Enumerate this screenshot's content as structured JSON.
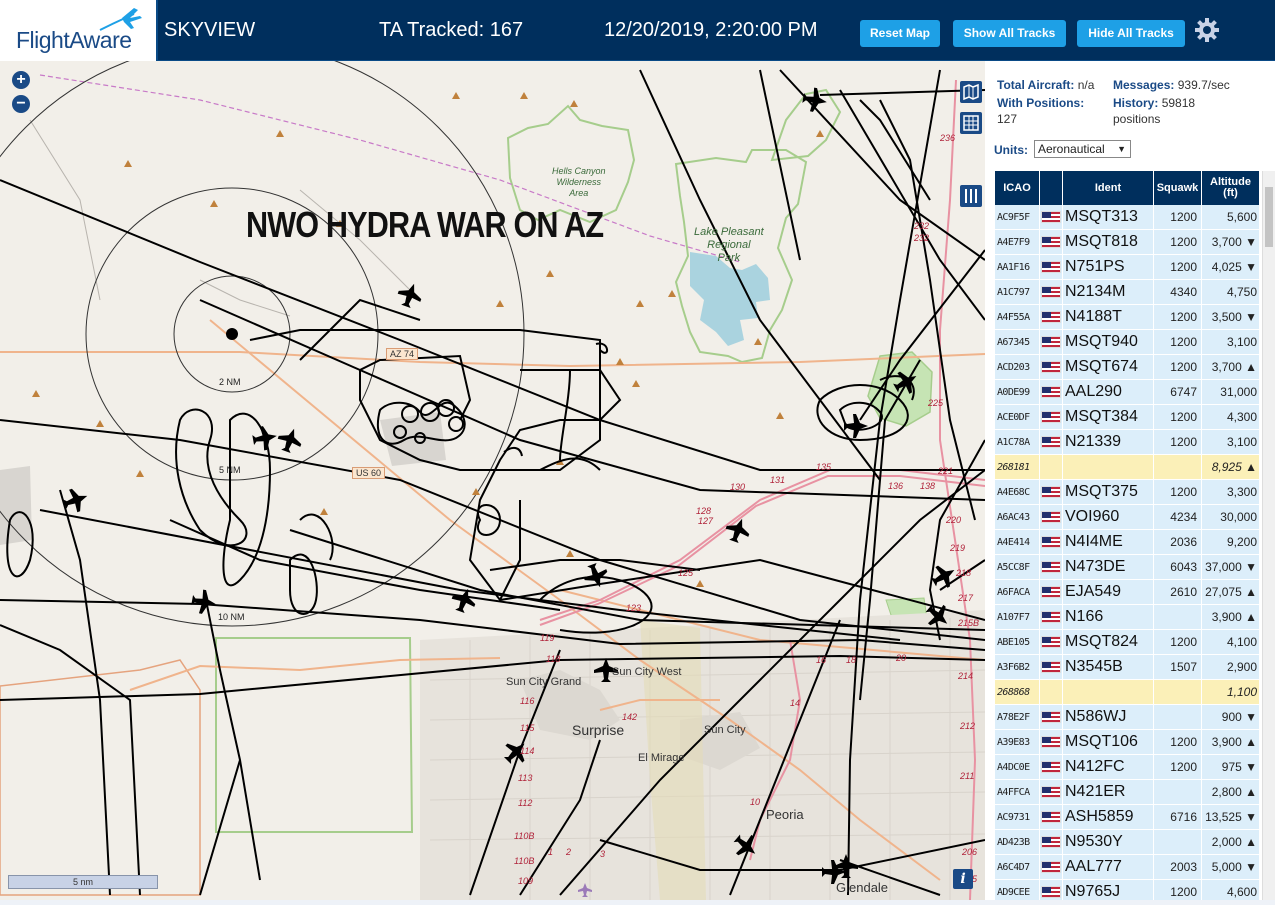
{
  "header": {
    "logo_text": "FlightAware",
    "app_title": "SKYVIEW",
    "tracked": "TA Tracked: 167",
    "datetime": "12/20/2019, 2:20:00 PM",
    "buttons": {
      "reset": "Reset Map",
      "show_all": "Show All Tracks",
      "hide_all": "Hide All Tracks"
    }
  },
  "map": {
    "overlay_title": "NWO HYDRA WAR ON AZ",
    "scale": "5 nm",
    "range_rings": [
      "2 NM",
      "5 NM",
      "10 NM"
    ],
    "places": {
      "hells_canyon": "Hells Canyon\nWilderness\nArea",
      "lake_pleasant": "Lake Pleasant\nRegional\nPark",
      "sun_city_grand": "Sun City Grand",
      "sun_city_west": "Sun City West",
      "surprise": "Surprise",
      "sun_city": "Sun City",
      "el_mirage": "El Mirage",
      "peoria": "Peoria",
      "glendale": "Glendale"
    },
    "roads": {
      "az74": "AZ 74",
      "us60": "US 60"
    },
    "route_numbers": [
      "119",
      "116",
      "115",
      "114",
      "113",
      "112",
      "110B",
      "110B",
      "109",
      "118",
      "125",
      "123",
      "128",
      "127",
      "130",
      "131",
      "135",
      "136",
      "138",
      "142",
      "232",
      "232",
      "225",
      "221",
      "220",
      "219",
      "218",
      "217",
      "215B",
      "214",
      "212",
      "211",
      "206",
      "205",
      "236",
      "10",
      "14",
      "16",
      "18",
      "20",
      "1",
      "2",
      "3"
    ]
  },
  "panel": {
    "total_aircraft_label": "Total Aircraft:",
    "total_aircraft_value": "n/a",
    "messages_label": "Messages:",
    "messages_value": "939.7/sec",
    "with_positions_label": "With Positions:",
    "with_positions_value": "127",
    "history_label": "History:",
    "history_value": "59818",
    "history_unit": "positions",
    "units_label": "Units:",
    "units_value": "Aeronautical",
    "columns": [
      "ICAO",
      "",
      "Ident",
      "Squawk",
      "Altitude\n(ft)"
    ],
    "rows": [
      {
        "icao": "AC9F5F",
        "ident": "MSQT313",
        "squawk": "1200",
        "alt": "5,600",
        "flag": true
      },
      {
        "icao": "A4E7F9",
        "ident": "MSQT818",
        "squawk": "1200",
        "alt": "3,700 ▼",
        "flag": true
      },
      {
        "icao": "AA1F16",
        "ident": "N751PS",
        "squawk": "1200",
        "alt": "4,025 ▼",
        "flag": true
      },
      {
        "icao": "A1C797",
        "ident": "N2134M",
        "squawk": "4340",
        "alt": "4,750",
        "flag": true
      },
      {
        "icao": "A4F55A",
        "ident": "N4188T",
        "squawk": "1200",
        "alt": "3,500 ▼",
        "flag": true
      },
      {
        "icao": "A67345",
        "ident": "MSQT940",
        "squawk": "1200",
        "alt": "3,100",
        "flag": true
      },
      {
        "icao": "ACD203",
        "ident": "MSQT674",
        "squawk": "1200",
        "alt": "3,700 ▲",
        "flag": true
      },
      {
        "icao": "A0DE99",
        "ident": "AAL290",
        "squawk": "6747",
        "alt": "31,000",
        "flag": true
      },
      {
        "icao": "ACE0DF",
        "ident": "MSQT384",
        "squawk": "1200",
        "alt": "4,300",
        "flag": true
      },
      {
        "icao": "A1C78A",
        "ident": "N21339",
        "squawk": "1200",
        "alt": "3,100",
        "flag": true
      },
      {
        "icao": "268181",
        "ident": "",
        "squawk": "",
        "alt": "8,925 ▲",
        "flag": false,
        "highlight": true
      },
      {
        "icao": "A4E68C",
        "ident": "MSQT375",
        "squawk": "1200",
        "alt": "3,300",
        "flag": true
      },
      {
        "icao": "A6AC43",
        "ident": "VOI960",
        "squawk": "4234",
        "alt": "30,000",
        "flag": true
      },
      {
        "icao": "A4E414",
        "ident": "N4I4ME",
        "squawk": "2036",
        "alt": "9,200",
        "flag": true
      },
      {
        "icao": "A5CC8F",
        "ident": "N473DE",
        "squawk": "6043",
        "alt": "37,000 ▼",
        "flag": true
      },
      {
        "icao": "A6FACA",
        "ident": "EJA549",
        "squawk": "2610",
        "alt": "27,075 ▲",
        "flag": true
      },
      {
        "icao": "A107F7",
        "ident": "N166",
        "squawk": "",
        "alt": "3,900 ▲",
        "flag": true
      },
      {
        "icao": "ABE105",
        "ident": "MSQT824",
        "squawk": "1200",
        "alt": "4,100",
        "flag": true
      },
      {
        "icao": "A3F6B2",
        "ident": "N3545B",
        "squawk": "1507",
        "alt": "2,900",
        "flag": true
      },
      {
        "icao": "268868",
        "ident": "",
        "squawk": "",
        "alt": "1,100",
        "flag": false,
        "highlight": true
      },
      {
        "icao": "A78E2F",
        "ident": "N586WJ",
        "squawk": "",
        "alt": "900 ▼",
        "flag": true
      },
      {
        "icao": "A39E83",
        "ident": "MSQT106",
        "squawk": "1200",
        "alt": "3,900 ▲",
        "flag": true
      },
      {
        "icao": "A4DC0E",
        "ident": "N412FC",
        "squawk": "1200",
        "alt": "975 ▼",
        "flag": true
      },
      {
        "icao": "A4FFCA",
        "ident": "N421ER",
        "squawk": "",
        "alt": "2,800 ▲",
        "flag": true
      },
      {
        "icao": "AC9731",
        "ident": "ASH5859",
        "squawk": "6716",
        "alt": "13,525 ▼",
        "flag": true
      },
      {
        "icao": "AD423B",
        "ident": "N9530Y",
        "squawk": "",
        "alt": "2,000 ▲",
        "flag": true
      },
      {
        "icao": "A6C4D7",
        "ident": "AAL777",
        "squawk": "2003",
        "alt": "5,000 ▼",
        "flag": true
      },
      {
        "icao": "AD9CEE",
        "ident": "N9765J",
        "squawk": "1200",
        "alt": "4,600",
        "flag": true
      }
    ]
  }
}
